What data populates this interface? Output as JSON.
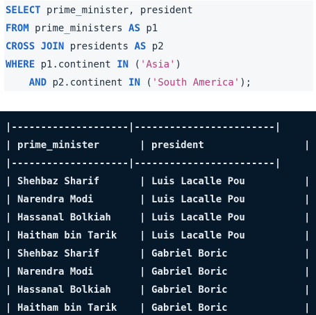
{
  "query": {
    "line1": {
      "kw": "SELECT",
      "rest": "prime_minister, president"
    },
    "line2": {
      "kw": "FROM",
      "mid": "prime_ministers",
      "kw2": "AS",
      "rest": "p1"
    },
    "line3": {
      "kw": "CROSS JOIN",
      "mid": "presidents",
      "kw2": "AS",
      "rest": "p2"
    },
    "line4": {
      "kw": "WHERE",
      "mid": "p1.continent",
      "kw2": "IN",
      "open": "(",
      "str": "'Asia'",
      "close": ")"
    },
    "line5": {
      "kw": "AND",
      "mid": "p2.continent",
      "kw2": "IN",
      "open": "(",
      "str": "'South America'",
      "close": ");"
    }
  },
  "colors": {
    "keyword": "#1c63c7",
    "string": "#c43779",
    "code_bg": "#f5f7f9",
    "result_bg": "#06192b",
    "result_text": "#e7ecf1"
  },
  "results": {
    "border_top": "|--------------------|------------------------|",
    "border_mid": "|--------------------|------------------------|",
    "headers": [
      "prime_minister",
      "president"
    ],
    "rows": [
      [
        "Shehbaz Sharif",
        "Luis Lacalle Pou"
      ],
      [
        "Narendra Modi",
        "Luis Lacalle Pou"
      ],
      [
        "Hassanal Bolkiah",
        "Luis Lacalle Pou"
      ],
      [
        "Haitham bin Tarik",
        "Luis Lacalle Pou"
      ],
      [
        "Shehbaz Sharif",
        "Gabriel Boric"
      ],
      [
        "Narendra Modi",
        "Gabriel Boric"
      ],
      [
        "Hassanal Bolkiah",
        "Gabriel Boric"
      ],
      [
        "Haitham bin Tarik",
        "Gabriel Boric"
      ]
    ]
  }
}
